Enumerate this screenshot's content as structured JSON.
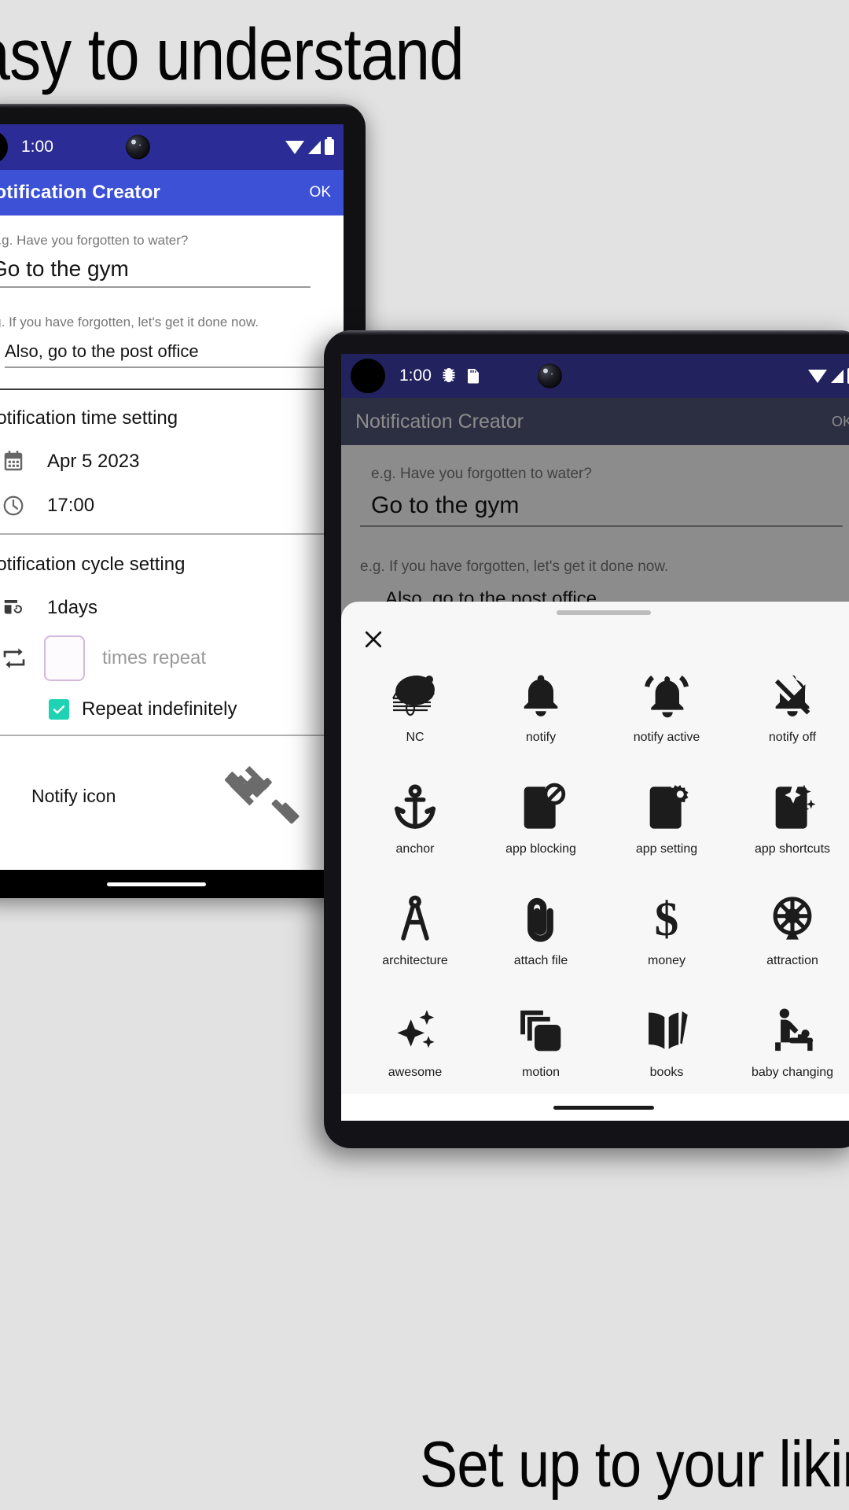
{
  "promo": {
    "top_headline": "Easy to understand",
    "bottom_headline": "Set up to your liking"
  },
  "colors": {
    "status_bar": "#2b2c96",
    "app_bar": "#3c51d6",
    "status_bar_2": "#22225e",
    "checkbox_teal": "#1ed3b4",
    "repeat_box_border": "#d5b8e0",
    "page_background": "#e2e2e2",
    "sheet_background": "#f7f7f7"
  },
  "phone1": {
    "status_bar": {
      "time": "1:00",
      "icons": [
        "wifi-icon",
        "signal-icon",
        "battery-icon"
      ]
    },
    "app_bar": {
      "title": "Notification Creator",
      "action_label": "OK"
    },
    "title_field": {
      "hint": "e.g. Have you forgotten to water?",
      "value": "Go to the gym"
    },
    "body_field": {
      "hint": "e.g. If you have forgotten, let's get it done now.",
      "value": "Also, go to the post office"
    },
    "time_section": {
      "title": "Notification time setting",
      "date_icon": "calendar-icon",
      "date_value": "Apr 5 2023",
      "clock_icon": "clock-icon",
      "time_value": "17:00"
    },
    "cycle_section": {
      "title": "Notification cycle setting",
      "interval_icon": "calendar-repeat-icon",
      "interval_value": "1days",
      "repeat_icon": "repeat-icon",
      "repeat_count_value": "",
      "repeat_count_label": "times repeat",
      "repeat_forever_label": "Repeat indefinitely",
      "repeat_forever_checked": true
    },
    "notify_icon_row": {
      "label": "Notify icon",
      "icon": "dumbbell-icon"
    }
  },
  "phone2": {
    "status_bar": {
      "time": "1:00",
      "icons": [
        "bug-icon",
        "sdcard-icon",
        "wifi-icon",
        "signal-icon",
        "battery-icon"
      ]
    },
    "app_bar": {
      "title": "Notification Creator",
      "action_label": "OK"
    },
    "title_field": {
      "hint": "e.g. Have you forgotten to water?",
      "value": "Go to the gym"
    },
    "body_field": {
      "hint": "e.g. If you have forgotten, let's get it done now.",
      "value": "Also, go to the post office"
    },
    "icon_picker_sheet": {
      "close_icon": "close-icon",
      "handle": "drag-handle",
      "icons": [
        {
          "label": "NC",
          "icon": "nc-logo-icon"
        },
        {
          "label": "notify",
          "icon": "bell-icon"
        },
        {
          "label": "notify active",
          "icon": "bell-active-icon"
        },
        {
          "label": "notify off",
          "icon": "bell-off-icon"
        },
        {
          "label": "anchor",
          "icon": "anchor-icon"
        },
        {
          "label": "app blocking",
          "icon": "app-blocking-icon"
        },
        {
          "label": "app setting",
          "icon": "app-setting-icon"
        },
        {
          "label": "app shortcuts",
          "icon": "app-shortcuts-icon"
        },
        {
          "label": "architecture",
          "icon": "architecture-icon"
        },
        {
          "label": "attach file",
          "icon": "attach-file-icon"
        },
        {
          "label": "money",
          "icon": "money-icon"
        },
        {
          "label": "attraction",
          "icon": "attraction-icon"
        },
        {
          "label": "awesome",
          "icon": "awesome-icon"
        },
        {
          "label": "motion",
          "icon": "motion-icon"
        },
        {
          "label": "books",
          "icon": "books-icon"
        },
        {
          "label": "baby changing",
          "icon": "baby-changing-icon"
        }
      ]
    }
  }
}
